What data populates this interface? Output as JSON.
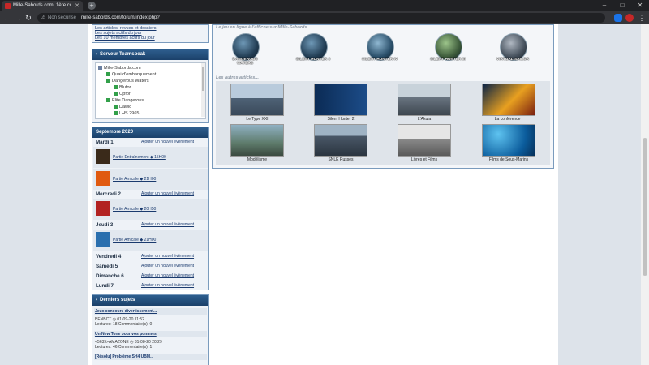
{
  "browser": {
    "tab_title": "Mille-Sabords.com, 1ère commu...",
    "security_label": "Non sécurisé",
    "url": "mille-sabords.com/forum/index.php?"
  },
  "sidebar": {
    "links": [
      "Les articles, revues et dossiers",
      "Les sujets actifs du jour",
      "Les 10 membres actifs du jour"
    ],
    "teamspeak": {
      "title": "Serveur Teamspeak",
      "server": "Mille-Sabords.com",
      "channels": [
        {
          "label": "Quai d'embarquement"
        },
        {
          "label": "Dangerous Waters"
        },
        {
          "label": "Blufor"
        },
        {
          "label": "Opfor"
        },
        {
          "label": "Elite Dangerous"
        },
        {
          "label": "Dawid"
        },
        {
          "label": "LHS 2965"
        }
      ]
    },
    "calendar": {
      "title": "Septembre 2020",
      "add_label": "Ajouter un nouvel évènement",
      "days": [
        "Mardi 1",
        "Mercredi 2",
        "Jeudi 3",
        "Vendredi 4",
        "Samedi 5",
        "Dimanche 6",
        "Lundi 7"
      ],
      "events": [
        {
          "label": "Partie Entraînement ◆ 15H00"
        },
        {
          "label": "Partie Amicale ◆ 21H00"
        },
        {
          "label": "Partie Amicale ◆ 20H50"
        },
        {
          "label": "Partie Amicale ◆ 21H00"
        }
      ]
    },
    "latest": {
      "title": "Derniers sujets",
      "topics": [
        {
          "title": "Jeux concours divertissement...",
          "meta1": "BENBCT ◷ 01-09-20 11:52",
          "meta2": "Lectures: 18   Commentaire(s): 0"
        },
        {
          "title": "Un New Tone pour vos pommes",
          "meta1": "<5639>AMAZONE ◷ 31-08-20 20:29",
          "meta2": "Lectures: 46   Commentaire(s): 1"
        },
        {
          "title": "[Résolu] Problème SH4 UBM...",
          "meta1": "",
          "meta2": ""
        }
      ]
    }
  },
  "main": {
    "games_title": "Le jeu en ligne à l'affiche sur Mille-Sabords...",
    "games": [
      {
        "name": "DANGEROUS WATERS"
      },
      {
        "name": "SILENT HUNTER 3"
      },
      {
        "name": "SILENT HUNTER IV"
      },
      {
        "name": "SILENT HUNTER III"
      },
      {
        "name": "VIRTUAL SAILOR"
      }
    ],
    "articles_title": "Les autres articles...",
    "articles": [
      {
        "caption": "Le Type XXI"
      },
      {
        "caption": "Silent Hunter 2"
      },
      {
        "caption": "L'Akula"
      },
      {
        "caption": "La conférence !"
      },
      {
        "caption": "Modélisme"
      },
      {
        "caption": "SNLE Russes"
      },
      {
        "caption": "Livres et Films"
      },
      {
        "caption": "Films de Sous-Marins"
      }
    ]
  },
  "colors": {
    "header": "#1b416a",
    "link": "#1a3a6e",
    "page_bg": "#dde3ea"
  }
}
